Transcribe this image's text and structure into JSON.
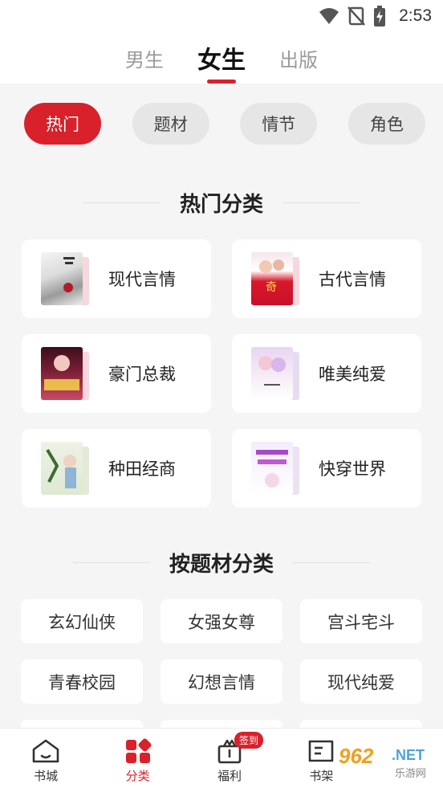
{
  "status_bar": {
    "time": "2:53"
  },
  "gender_tabs": [
    {
      "label": "男生",
      "active": false
    },
    {
      "label": "女生",
      "active": true
    },
    {
      "label": "出版",
      "active": false
    }
  ],
  "filter_chips": [
    {
      "label": "热门",
      "active": true
    },
    {
      "label": "题材",
      "active": false
    },
    {
      "label": "情节",
      "active": false
    },
    {
      "label": "角色",
      "active": false
    }
  ],
  "hot_section": {
    "title": "热门分类",
    "items": [
      {
        "label": "现代言情",
        "cover_icon": "book-cover-modern-romance"
      },
      {
        "label": "古代言情",
        "cover_icon": "book-cover-ancient-romance"
      },
      {
        "label": "豪门总裁",
        "cover_icon": "book-cover-ceo"
      },
      {
        "label": "唯美纯爱",
        "cover_icon": "book-cover-pure-love"
      },
      {
        "label": "种田经商",
        "cover_icon": "book-cover-farming"
      },
      {
        "label": "快穿世界",
        "cover_icon": "book-cover-quick-transmigration"
      }
    ]
  },
  "theme_section": {
    "title": "按题材分类",
    "tags": [
      "玄幻仙侠",
      "女强女尊",
      "宫斗宅斗",
      "青春校园",
      "幻想言情",
      "现代纯爱"
    ]
  },
  "bottom_nav": {
    "items": [
      {
        "label": "书城",
        "icon": "bookstore-icon",
        "active": false
      },
      {
        "label": "分类",
        "icon": "category-icon",
        "active": true
      },
      {
        "label": "福利",
        "icon": "gift-icon",
        "active": false,
        "badge": "签到"
      },
      {
        "label": "书架",
        "icon": "bookshelf-icon",
        "active": false
      }
    ]
  },
  "watermark": {
    "number": "962",
    "suffix": ".NET",
    "text": "乐游网"
  },
  "colors": {
    "accent": "#d8212a",
    "background": "#f5f5f5",
    "card": "#ffffff"
  }
}
